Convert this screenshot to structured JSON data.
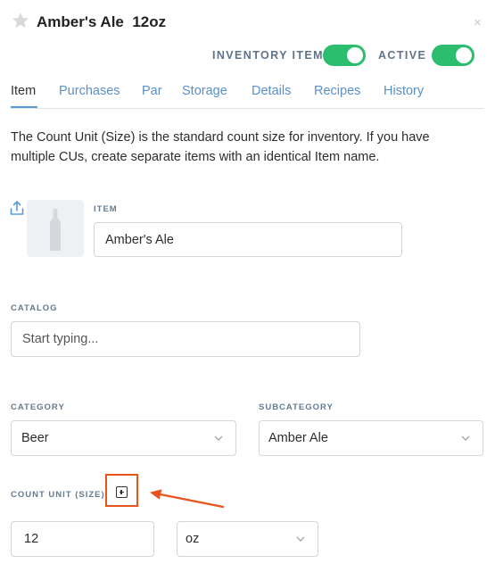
{
  "header": {
    "title": "Amber's Ale  12oz",
    "close_glyph": "×",
    "star_icon": "star-icon",
    "inventory_label": "INVENTORY ITEM",
    "inventory_on": true,
    "active_label": "ACTIVE",
    "active_on": true,
    "toggle_color": "#2dbd6e"
  },
  "tabs": [
    {
      "label": "Item",
      "active": true
    },
    {
      "label": "Purchases",
      "active": false
    },
    {
      "label": "Par",
      "active": false
    },
    {
      "label": "Storage",
      "active": false
    },
    {
      "label": "Details",
      "active": false
    },
    {
      "label": "Recipes",
      "active": false
    },
    {
      "label": "History",
      "active": false
    }
  ],
  "description": "The Count Unit (Size) is the standard count size for inventory. If you have multiple CUs, create separate items with an identical Item name.",
  "item": {
    "label": "ITEM",
    "value": "Amber's Ale",
    "upload_icon": "upload-icon",
    "image_icon": "bottle-icon"
  },
  "catalog": {
    "label": "CATALOG",
    "placeholder": "Start typing..."
  },
  "category": {
    "label": "CATEGORY",
    "value": "Beer"
  },
  "subcategory": {
    "label": "SUBCATEGORY",
    "value": "Amber Ale"
  },
  "count_unit": {
    "label": "COUNT UNIT (SIZE)",
    "quantity": "12",
    "unit": "oz",
    "add_icon": "plus-square-icon"
  },
  "annotation": {
    "color": "#e8541c"
  }
}
